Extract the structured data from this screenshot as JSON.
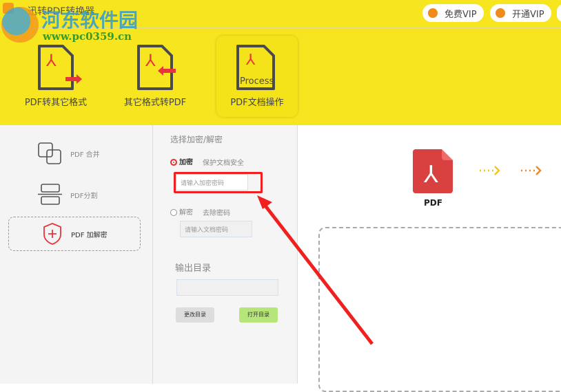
{
  "app": {
    "title": "迅转PDF转换器"
  },
  "watermark": {
    "name": "河东软件园",
    "url": "www.pc0359.cn"
  },
  "header": {
    "vip_buttons": [
      {
        "label": "免费VIP"
      },
      {
        "label": "开通VIP"
      }
    ],
    "tools": [
      {
        "label": "PDF转其它格式"
      },
      {
        "label": "其它格式转PDF"
      },
      {
        "label": "PDF文档操作",
        "icon_text": "Process"
      }
    ]
  },
  "sidebar": {
    "items": [
      {
        "label": "PDF 合并"
      },
      {
        "label": "PDF分割"
      },
      {
        "label": "PDF 加解密"
      }
    ]
  },
  "options": {
    "section_title": "选择加密/解密",
    "encrypt": {
      "label": "加密",
      "desc": "保护文档安全",
      "placeholder": "请输入加密密码"
    },
    "decrypt": {
      "label": "解密",
      "desc": "去除密码",
      "placeholder": "请输入文档密码"
    },
    "output_title": "输出目录",
    "output_value": "",
    "change_dir": "更改目录",
    "open_dir": "打开目录"
  },
  "preview": {
    "file_label": "PDF"
  }
}
